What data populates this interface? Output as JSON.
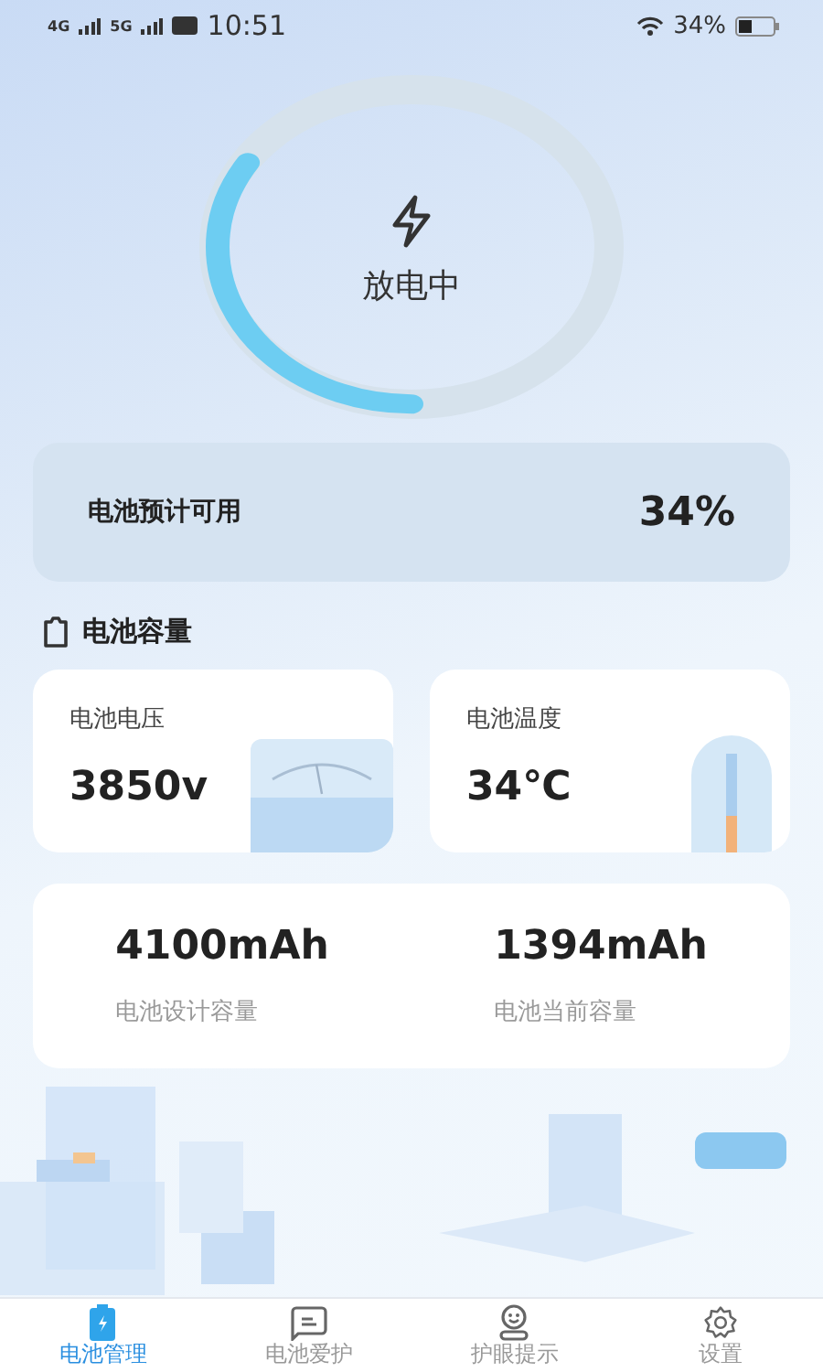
{
  "status_bar": {
    "network_1": "4G",
    "network_2": "5G",
    "time": "10:51",
    "battery_percent": "34%"
  },
  "discharge_ring": {
    "level": 0.34,
    "status": "放电中"
  },
  "estimate": {
    "label": "电池预计可用",
    "value": "34%"
  },
  "section_title": "电池容量",
  "stats": [
    {
      "kind": "voltage",
      "label": "电池电压",
      "value": "3850v"
    },
    {
      "kind": "temperature",
      "label": "电池温度",
      "value": "34℃"
    }
  ],
  "capacity": [
    {
      "value": "4100mAh",
      "label": "电池设计容量"
    },
    {
      "value": "1394mAh",
      "label": "电池当前容量"
    }
  ],
  "tabs": [
    {
      "kind": "battery",
      "label": "电池管理",
      "selected": true
    },
    {
      "kind": "chat",
      "label": "电池爱护",
      "selected": false
    },
    {
      "kind": "face",
      "label": "护眼提示",
      "selected": false
    },
    {
      "kind": "gear",
      "label": "设置",
      "selected": false
    }
  ]
}
